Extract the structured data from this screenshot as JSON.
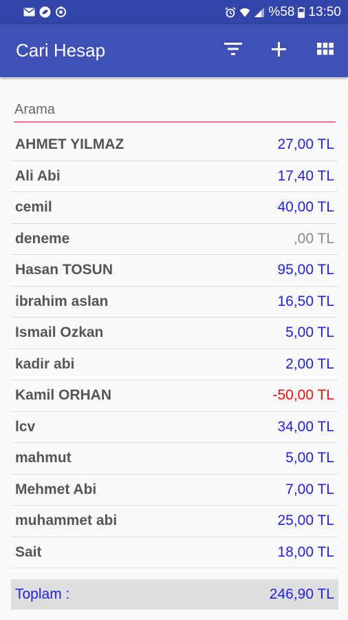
{
  "status_bar": {
    "battery": "%58",
    "time": "13:50",
    "left_icons": [
      "mail-icon",
      "app-notification-icon",
      "sync-icon"
    ],
    "right_icons": [
      "alarm-icon",
      "wifi-icon",
      "signal-icon",
      "battery-icon"
    ]
  },
  "app_bar": {
    "title": "Cari Hesap",
    "actions": [
      "filter-icon",
      "plus-icon",
      "grid-icon"
    ]
  },
  "search": {
    "placeholder": "Arama",
    "value": ""
  },
  "accounts": [
    {
      "name": "AHMET YILMAZ",
      "amount": "27,00 TL",
      "color": "#2222dd"
    },
    {
      "name": "Ali Abi",
      "amount": "17,40 TL",
      "color": "#2222dd"
    },
    {
      "name": "cemil",
      "amount": "40,00 TL",
      "color": "#2222dd"
    },
    {
      "name": "deneme",
      "amount": ",00 TL",
      "color": "#8a8a8a"
    },
    {
      "name": "Hasan TOSUN",
      "amount": "95,00 TL",
      "color": "#2222dd"
    },
    {
      "name": "ibrahim aslan",
      "amount": "16,50 TL",
      "color": "#2222dd"
    },
    {
      "name": "Ismail Ozkan",
      "amount": "5,00 TL",
      "color": "#2222dd"
    },
    {
      "name": "kadir abi",
      "amount": "2,00 TL",
      "color": "#2222dd"
    },
    {
      "name": "Kamil ORHAN",
      "amount": "-50,00 TL",
      "color": "#ee1111"
    },
    {
      "name": "lcv",
      "amount": "34,00 TL",
      "color": "#2222dd"
    },
    {
      "name": "mahmut",
      "amount": "5,00 TL",
      "color": "#2222dd"
    },
    {
      "name": "Mehmet Abi",
      "amount": "7,00 TL",
      "color": "#2222dd"
    },
    {
      "name": "muhammet abi",
      "amount": "25,00 TL",
      "color": "#2222dd"
    },
    {
      "name": "Sait",
      "amount": "18,00 TL",
      "color": "#2222dd"
    }
  ],
  "total": {
    "label": "Toplam :",
    "amount": "246,90 TL",
    "color": "#2222dd"
  },
  "colors": {
    "status_bar": "#3345a8",
    "app_bar": "#3f51b5",
    "search_underline": "#ee6e95",
    "positive": "#2222dd",
    "negative": "#ee1111",
    "zero": "#8a8a8a"
  }
}
